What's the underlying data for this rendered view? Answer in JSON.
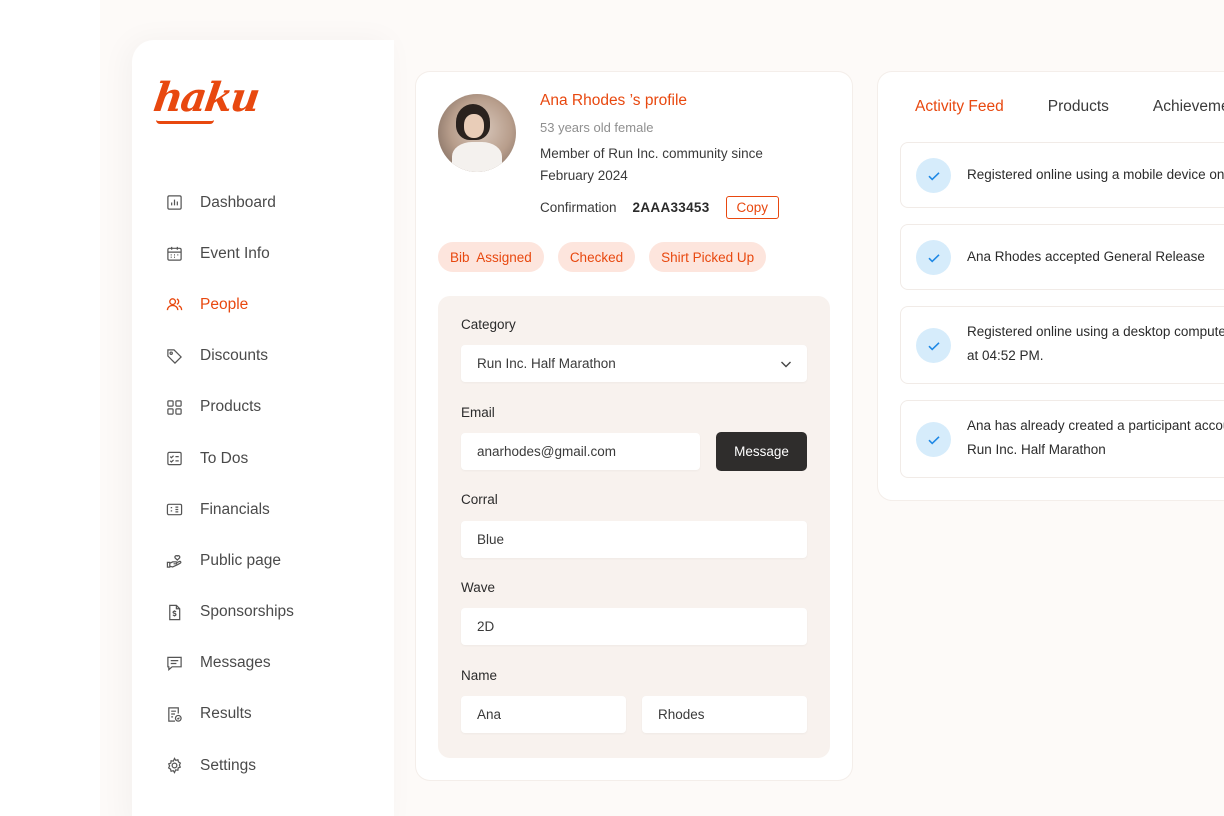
{
  "brand": {
    "logo": "haku",
    "accent": "#e8480f"
  },
  "sidebar": {
    "items": [
      {
        "label": "Dashboard",
        "icon": "dashboard-icon",
        "active": false
      },
      {
        "label": "Event Info",
        "icon": "calendar-icon",
        "active": false
      },
      {
        "label": "People",
        "icon": "people-icon",
        "active": true
      },
      {
        "label": "Discounts",
        "icon": "tag-icon",
        "active": false
      },
      {
        "label": "Products",
        "icon": "grid-icon",
        "active": false
      },
      {
        "label": "To Dos",
        "icon": "checklist-icon",
        "active": false
      },
      {
        "label": "Financials",
        "icon": "money-icon",
        "active": false
      },
      {
        "label": "Public page",
        "icon": "hand-heart-icon",
        "active": false
      },
      {
        "label": "Sponsorships",
        "icon": "document-dollar-icon",
        "active": false
      },
      {
        "label": "Messages",
        "icon": "message-icon",
        "active": false
      },
      {
        "label": "Results",
        "icon": "results-icon",
        "active": false
      },
      {
        "label": "Settings",
        "icon": "gear-icon",
        "active": false
      }
    ]
  },
  "profile": {
    "title": "Ana Rhodes ’s profile",
    "subtitle": "53 years old female",
    "member": "Member of Run Inc. community since February 2024",
    "confirmation_label": "Confirmation",
    "confirmation_value": "2AAA33453",
    "copy_label": "Copy",
    "badges": [
      "Bib  Assigned",
      "Checked",
      "Shirt Picked Up"
    ]
  },
  "form": {
    "category_label": "Category",
    "category_value": "Run Inc. Half Marathon",
    "email_label": "Email",
    "email_value": "anarhodes@gmail.com",
    "message_button": "Message",
    "corral_label": "Corral",
    "corral_value": "Blue",
    "wave_label": "Wave",
    "wave_value": "2D",
    "name_label": "Name",
    "first_name": "Ana",
    "last_name": "Rhodes"
  },
  "activity": {
    "tabs": [
      {
        "label": "Activity Feed",
        "active": true
      },
      {
        "label": "Products",
        "active": false
      },
      {
        "label": "Achievements",
        "active": false
      }
    ],
    "feed": [
      {
        "line1": "Registered online using a mobile device on",
        "line2": ""
      },
      {
        "line1": "Ana Rhodes accepted General Release",
        "line2": ""
      },
      {
        "line1": "Registered online using a desktop computer",
        "line2": "at 04:52 PM."
      },
      {
        "line1": "Ana has already created a participant account for",
        "line2": "Run Inc. Half Marathon"
      }
    ]
  }
}
